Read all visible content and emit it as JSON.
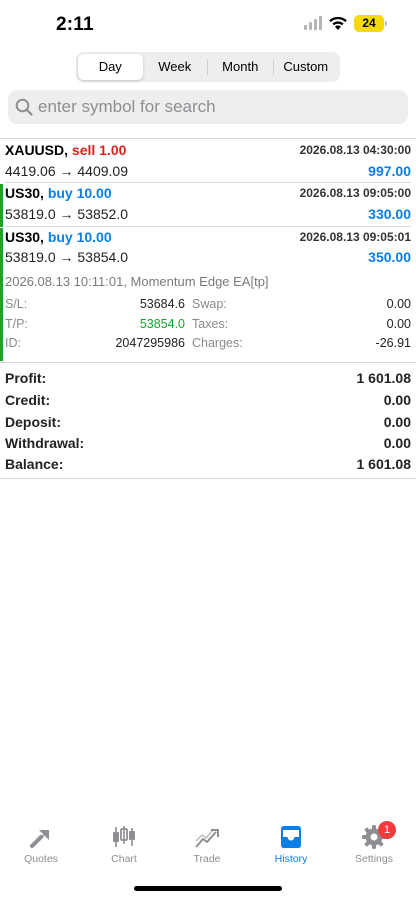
{
  "status_bar": {
    "time": "2:11",
    "battery": "24"
  },
  "periods": [
    {
      "label": "Day",
      "active": true
    },
    {
      "label": "Week",
      "active": false
    },
    {
      "label": "Month",
      "active": false
    },
    {
      "label": "Custom",
      "active": false
    }
  ],
  "search": {
    "placeholder": "enter symbol for search"
  },
  "deals": [
    {
      "symbol": "XAUUSD,",
      "side": "sell 1.00",
      "side_color": "#e02020",
      "date": "2026.08.13 04:30:00",
      "prices": "4419.06 → 4409.09",
      "profit": "997.00"
    },
    {
      "symbol": "US30,",
      "side": "buy 10.00",
      "side_color": "#0b7ee6",
      "date": "2026.08.13 09:05:00",
      "prices": "53819.0 → 53852.0",
      "profit": "330.00"
    },
    {
      "symbol": "US30,",
      "side": "buy 10.00",
      "side_color": "#0b7ee6",
      "date": "2026.08.13 09:05:01",
      "prices": "53819.0 → 53854.0",
      "profit": "350.00"
    }
  ],
  "details": {
    "time_comment": "2026.08.13 10:11:01, Momentum Edge EA[tp]",
    "sl_label": "S/L:",
    "sl_value": "53684.6",
    "swap_label": "Swap:",
    "swap_value": "0.00",
    "tp_label": "T/P:",
    "tp_value": "53854.0",
    "taxes_label": "Taxes:",
    "taxes_value": "0.00",
    "id_label": "ID:",
    "id_value": "2047295986",
    "charges_label": "Charges:",
    "charges_value": "-26.91"
  },
  "summary": {
    "profit_label": "Profit:",
    "profit_value": "1 601.08",
    "credit_label": "Credit:",
    "credit_value": "0.00",
    "deposit_label": "Deposit:",
    "deposit_value": "0.00",
    "withdrawal_label": "Withdrawal:",
    "withdrawal_value": "0.00",
    "balance_label": "Balance:",
    "balance_value": "1 601.08"
  },
  "tabs": {
    "quotes": "Quotes",
    "chart": "Chart",
    "trade": "Trade",
    "history": "History",
    "settings": "Settings",
    "settings_badge": "1"
  },
  "colors": {
    "accent": "#0b7ee6",
    "sell": "#e02020",
    "buy": "#0b7ee6",
    "tp_green": "#19a52a",
    "badge": "#ef3b3b"
  }
}
